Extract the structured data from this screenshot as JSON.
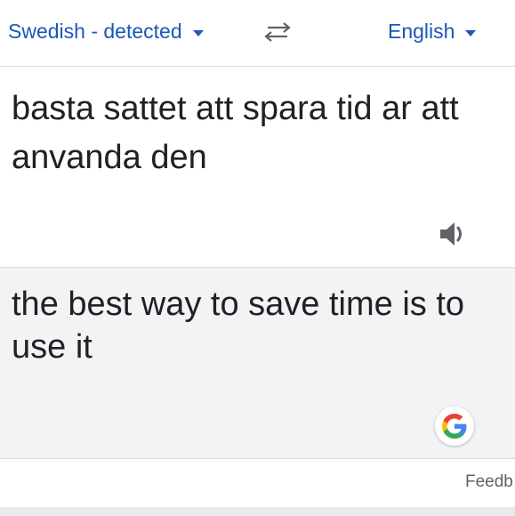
{
  "languages": {
    "source_label": "Swedish - detected",
    "target_label": "English"
  },
  "source": {
    "text": "basta sattet att spara tid ar att anvanda den"
  },
  "translation": {
    "text": "the best way to save time is to use it"
  },
  "footer": {
    "feedback_label": "Feedb"
  },
  "icons": {
    "swap": "swap-arrows-icon",
    "speaker": "speaker-icon",
    "google": "google-g-icon"
  },
  "colors": {
    "accent": "#1a57b8",
    "text": "#202124",
    "muted": "#5f6368",
    "translation_bg": "#f1f3f4",
    "divider": "#dadce0"
  }
}
